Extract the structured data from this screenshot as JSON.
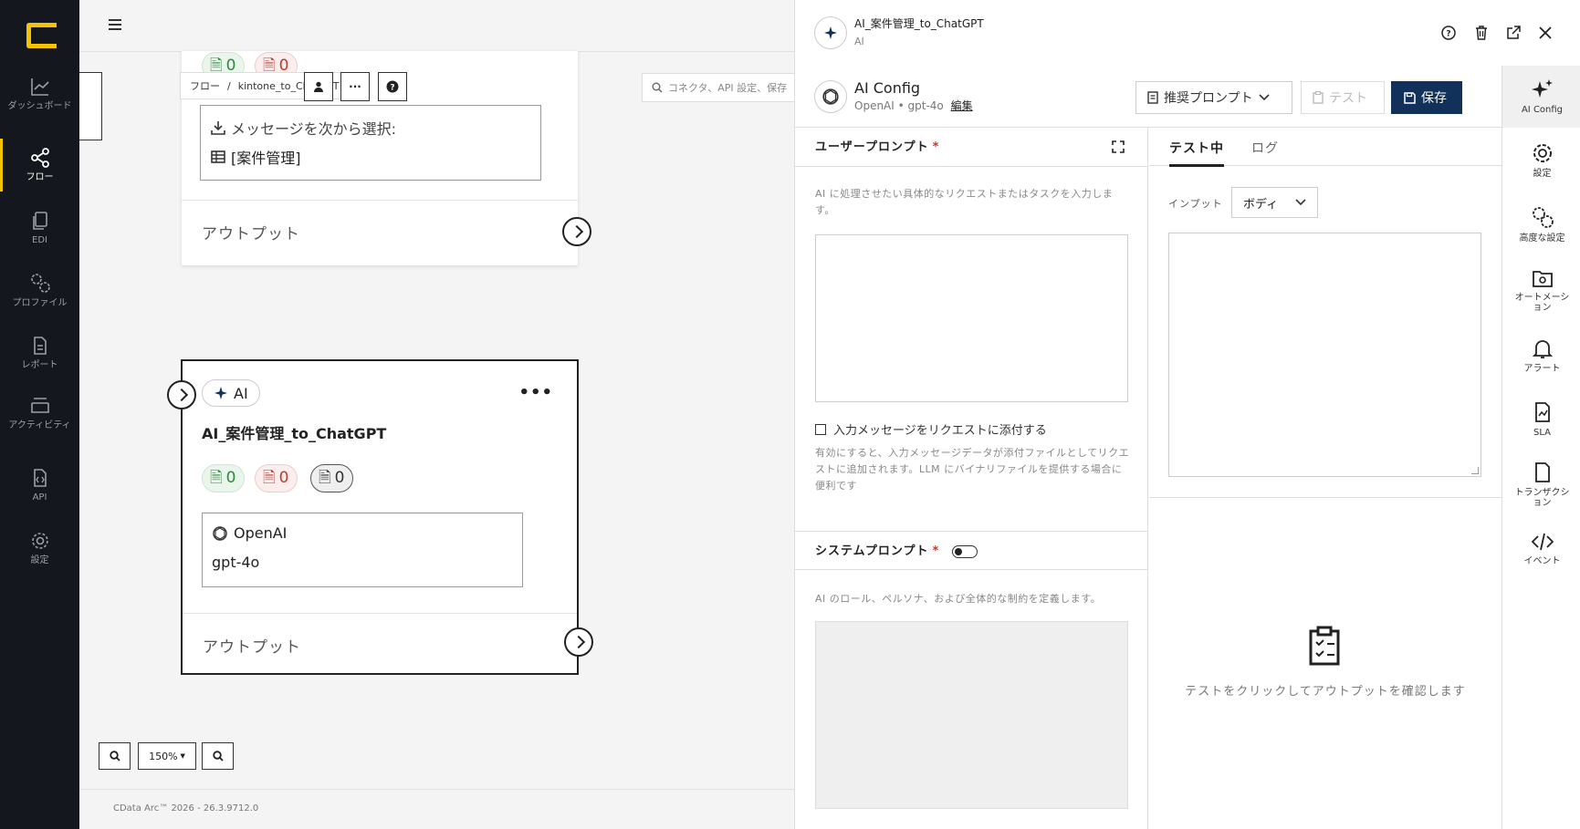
{
  "nav": {
    "items": [
      {
        "label": "ダッシュボード",
        "icon": "chart-line-icon"
      },
      {
        "label": "フロー",
        "icon": "flow-icon",
        "active": true
      },
      {
        "label": "EDI",
        "icon": "documents-icon"
      },
      {
        "label": "プロファイル",
        "icon": "gears-icon"
      },
      {
        "label": "レポート",
        "icon": "report-icon"
      },
      {
        "label": "アクティビティ",
        "icon": "layers-icon"
      },
      {
        "label": "API",
        "icon": "api-icon"
      },
      {
        "label": "設定",
        "icon": "gear-icon"
      }
    ]
  },
  "canvas": {
    "breadcrumb": {
      "root": "フロー",
      "separator": "/",
      "current": "kintone_to_ChatGPT"
    },
    "search_placeholder": "コネクタ、API 設定、保存",
    "node1": {
      "pill_green": "0",
      "pill_red": "0",
      "select_label": "メッセージを次から選択:",
      "select_value": "[案件管理]",
      "output_label": "アウトプット"
    },
    "node2": {
      "type_label": "AI",
      "title": "AI_案件管理_to_ChatGPT",
      "pill_green": "0",
      "pill_red": "0",
      "pill_gray": "0",
      "provider": "OpenAI",
      "model": "gpt-4o",
      "output_label": "アウトプット"
    },
    "zoom_level": "150%",
    "footer": "CData Arc™ 2026 - 26.3.9712.0"
  },
  "panel": {
    "title": "AI_案件管理_to_ChatGPT",
    "subtitle": "AI",
    "config": {
      "title": "AI Config",
      "subtitle": "OpenAI • gpt-4o",
      "edit_link": "編集",
      "recommend_button": "推奨プロンプト",
      "test_button": "テスト",
      "save_button": "保存"
    },
    "user_prompt": {
      "label": "ユーザープロンプト",
      "required_mark": "*",
      "help": "AI に処理させたい具体的なリクエストまたはタスクを入力します。",
      "attach_label": "入力メッセージをリクエストに添付する",
      "attach_help": "有効にすると、入力メッセージデータが添付ファイルとしてリクエストに追加されます。LLM にバイナリファイルを提供する場合に便利です"
    },
    "system_prompt": {
      "label": "システムプロンプト",
      "required_mark": "*",
      "help": "AI のロール、ペルソナ、および全体的な制約を定義します。"
    },
    "tabs": [
      {
        "label": "テスト中",
        "active": true
      },
      {
        "label": "ログ",
        "active": false
      }
    ],
    "input_label": "インプット",
    "input_select": "ボディ",
    "empty_message": "テストをクリックしてアウトプットを確認します"
  },
  "rail": {
    "items": [
      {
        "label": "AI Config",
        "icon": "sparkles-icon",
        "active": true
      },
      {
        "label": "設定",
        "icon": "gear-icon"
      },
      {
        "label": "高度な設定",
        "icon": "gears-icon"
      },
      {
        "label": "オートメーション",
        "icon": "folder-gear-icon"
      },
      {
        "label": "アラート",
        "icon": "bell-icon"
      },
      {
        "label": "SLA",
        "icon": "sla-icon"
      },
      {
        "label": "トランザクション",
        "icon": "file-icon"
      },
      {
        "label": "イベント",
        "icon": "code-icon"
      }
    ]
  },
  "colors": {
    "nav_bg": "#14181e",
    "accent": "#f5c400",
    "primary": "#12315a"
  }
}
